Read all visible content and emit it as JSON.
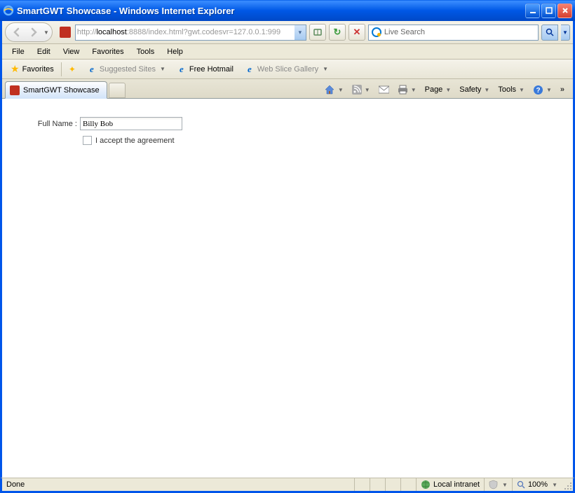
{
  "titlebar": {
    "title": "SmartGWT Showcase - Windows Internet Explorer"
  },
  "navbar": {
    "url_prefix": "http://",
    "url_host": "localhost",
    "url_rest": ":8888/index.html?gwt.codesvr=127.0.0.1:999",
    "search_placeholder": "Live Search"
  },
  "menubar": {
    "items": [
      "File",
      "Edit",
      "View",
      "Favorites",
      "Tools",
      "Help"
    ]
  },
  "favbar": {
    "favorites_label": "Favorites",
    "suggested_label": "Suggested Sites",
    "hotmail_label": "Free Hotmail",
    "slice_label": "Web Slice Gallery"
  },
  "tabbar": {
    "tab_label": "SmartGWT Showcase",
    "cmds": {
      "page": "Page",
      "safety": "Safety",
      "tools": "Tools"
    }
  },
  "content": {
    "fullname_label": "Full Name :",
    "fullname_value": "Billy Bob",
    "agreement_label": "I accept the agreement"
  },
  "statusbar": {
    "status_text": "Done",
    "zone_text": "Local intranet",
    "zoom_text": "100%"
  }
}
